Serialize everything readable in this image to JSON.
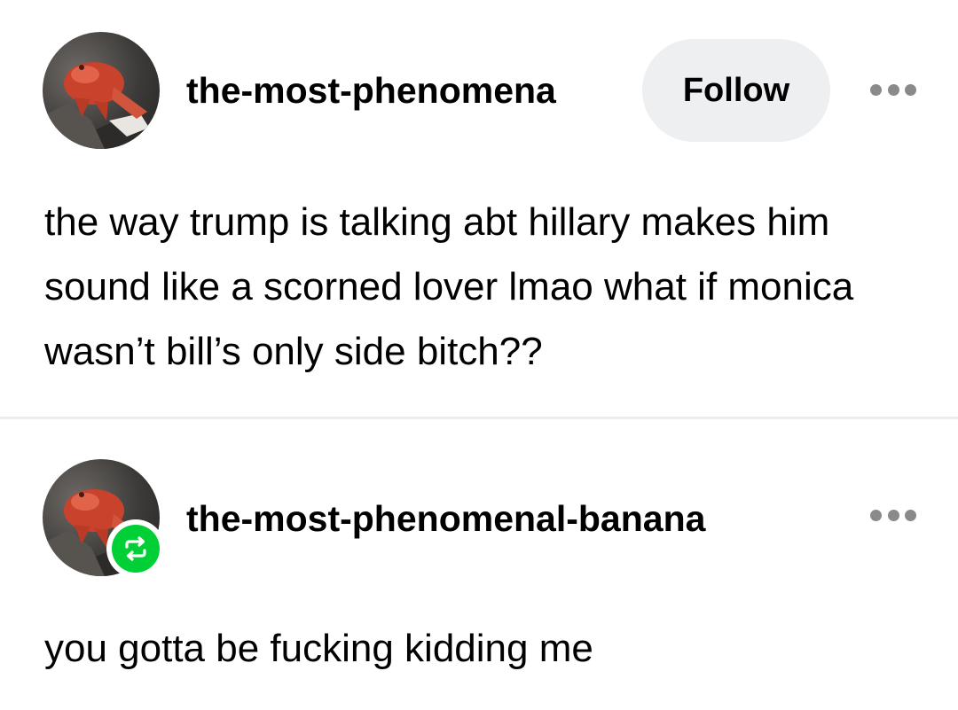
{
  "posts": [
    {
      "username": "the-most-phenomena",
      "follow_label": "Follow",
      "avatar_icon": "red-fish-avatar-icon",
      "more_icon": "more-options-icon",
      "text": "the way trump is talking abt hillary makes him sound like a scorned lover lmao what if monica wasn’t bill’s only side bitch??"
    },
    {
      "username": "the-most-phenomenal-banana",
      "avatar_icon": "red-fish-avatar-icon",
      "badge_icon": "reblog-icon",
      "more_icon": "more-options-icon",
      "text": "you gotta be fucking kidding me"
    }
  ],
  "colors": {
    "follow_bg": "#eeeff1",
    "reblog_green": "#00cf35",
    "dots_gray": "#8a8a8a",
    "divider": "#ececec"
  }
}
